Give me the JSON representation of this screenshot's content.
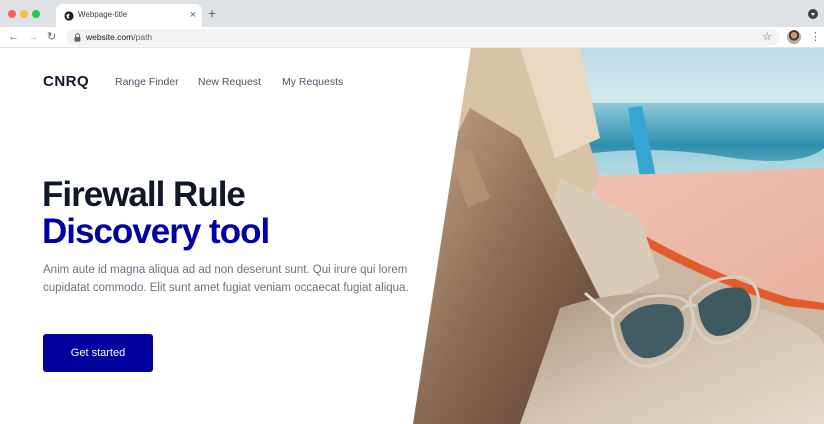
{
  "browser": {
    "tab_title": "Webpage-title",
    "tab_close": "×",
    "new_tab": "+",
    "url_domain": "website.com",
    "url_path": "/path",
    "back": "←",
    "forward": "→",
    "reload": "↻",
    "star": "☆",
    "menu": "⋮"
  },
  "header": {
    "logo": "CNRQ",
    "nav": [
      "Range Finder",
      "New Request",
      "My Requests"
    ]
  },
  "hero": {
    "title_line1": "Firewall Rule",
    "title_line2": "Discovery tool",
    "description": "Anim aute id magna aliqua ad ad non deserunt sunt. Qui irure qui lorem cupidatat commodo. Elit sunt amet fugiat veniam occaecat fugiat aliqua.",
    "cta_label": "Get started"
  },
  "colors": {
    "brand_blue": "#00009c",
    "title_blue": "#0000a3",
    "title_dark": "#111827",
    "text_gray": "#6b7280"
  },
  "icons": {
    "favicon": "globe-favicon-icon",
    "lock": "lock-icon",
    "star": "star-icon",
    "avatar": "user-avatar",
    "menu": "kebab-menu-icon"
  }
}
